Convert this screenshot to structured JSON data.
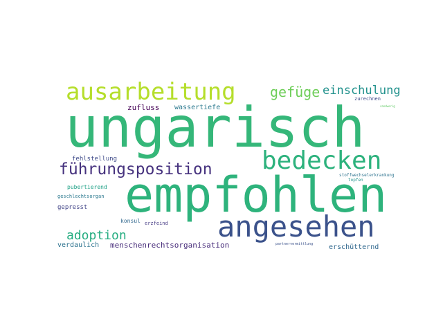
{
  "words": [
    {
      "id": "ungarisch",
      "text": "ungarisch",
      "color": "#35b779"
    },
    {
      "id": "empfohlen",
      "text": "empfohlen",
      "color": "#2eb37c"
    },
    {
      "id": "ausarbeitung",
      "text": "ausarbeitung",
      "color": "#b5de2b"
    },
    {
      "id": "angesehen",
      "text": "angesehen",
      "color": "#3b528b"
    },
    {
      "id": "bedecken",
      "text": "bedecken",
      "color": "#2db27d"
    },
    {
      "id": "fuehrungsposition",
      "text": "führungsposition",
      "color": "#46327e"
    },
    {
      "id": "gefuege",
      "text": "gefüge",
      "color": "#6ece58"
    },
    {
      "id": "einschulung",
      "text": "einschulung",
      "color": "#21918c"
    },
    {
      "id": "adoption",
      "text": "adoption",
      "color": "#26ad81"
    },
    {
      "id": "zufluss",
      "text": "zufluss",
      "color": "#440154"
    },
    {
      "id": "wassertiefe",
      "text": "wassertiefe",
      "color": "#2a788e"
    },
    {
      "id": "fehlstellung",
      "text": "fehlstellung",
      "color": "#3e4a89"
    },
    {
      "id": "menschenrechtsorganisation",
      "text": "menschenrechtsorganisation",
      "color": "#472c7a"
    },
    {
      "id": "erschuetternd",
      "text": "erschütternd",
      "color": "#31688e"
    },
    {
      "id": "verdaulich",
      "text": "verdaulich",
      "color": "#2c728e"
    },
    {
      "id": "gepresst",
      "text": "gepresst",
      "color": "#414487"
    },
    {
      "id": "pubertierend",
      "text": "pubertierend",
      "color": "#1fa187"
    },
    {
      "id": "geschlechtsorgan",
      "text": "geschlechtsorgan",
      "color": "#2a788e"
    },
    {
      "id": "konsul",
      "text": "konsul",
      "color": "#31688e"
    },
    {
      "id": "erzfeind",
      "text": "erzfeind",
      "color": "#443983"
    },
    {
      "id": "zurechnen",
      "text": "zurechnen",
      "color": "#3e4a89"
    },
    {
      "id": "stoffwechselerkrankung",
      "text": "stoffwechselerkrankung",
      "color": "#2c728e"
    },
    {
      "id": "topfen",
      "text": "topfen",
      "color": "#21918c"
    },
    {
      "id": "partnervermittlung",
      "text": "partnervermittlung",
      "color": "#3b528b"
    },
    {
      "id": "sandwerk",
      "text": "sandwerig",
      "color": "#5ec962"
    }
  ]
}
